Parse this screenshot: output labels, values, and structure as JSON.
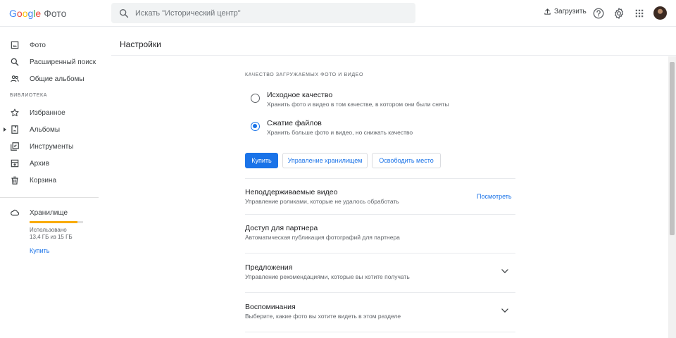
{
  "app": {
    "logo_g": "G",
    "logo_o1": "o",
    "logo_o2": "o",
    "logo_g2": "g",
    "logo_l": "l",
    "logo_e": "e",
    "product": "Фото"
  },
  "search": {
    "placeholder": "Искать \"Исторический центр\"",
    "icon": "search-icon"
  },
  "toolbar": {
    "upload_label": "Загрузить",
    "icons": [
      "upload-icon",
      "help-icon",
      "gear-icon",
      "apps-grid-icon",
      "avatar"
    ]
  },
  "sidebar": {
    "items": [
      {
        "label": "Фото",
        "icon": "photo-icon"
      },
      {
        "label": "Расширенный поиск",
        "icon": "search-icon"
      },
      {
        "label": "Общие альбомы",
        "icon": "people-icon"
      }
    ],
    "library_label": "БИБЛИОТЕКА",
    "library_items": [
      {
        "label": "Избранное",
        "icon": "star-icon"
      },
      {
        "label": "Альбомы",
        "icon": "album-icon"
      },
      {
        "label": "Инструменты",
        "icon": "tools-icon"
      },
      {
        "label": "Архив",
        "icon": "archive-icon"
      },
      {
        "label": "Корзина",
        "icon": "trash-icon"
      }
    ],
    "storage": {
      "label": "Хранилище",
      "used_label": "Использовано",
      "used_value": "13,4 ГБ из 15 ГБ",
      "used_fraction": 0.893,
      "bar_color": "#f9ab00",
      "buy_label": "Купить"
    }
  },
  "main": {
    "title": "Настройки",
    "upload_quality_label": "КАЧЕСТВО ЗАГРУЖАЕМЫХ ФОТО И ВИДЕО",
    "options": [
      {
        "title": "Исходное качество",
        "desc": "Хранить фото и видео в том качестве, в котором они были сняты",
        "checked": false
      },
      {
        "title": "Сжатие файлов",
        "desc": "Хранить больше фото и видео, но снижать качество",
        "checked": true
      }
    ],
    "buttons": {
      "buy": "Купить",
      "manage": "Управление хранилищем",
      "free": "Освободить место"
    },
    "rows": [
      {
        "title": "Неподдерживаемые видео",
        "desc": "Управление роликами, которые не удалось обработать",
        "action": "Посмотреть"
      },
      {
        "title": "Доступ для партнера",
        "desc": "Автоматическая публикация фотографий для партнера"
      },
      {
        "title": "Предложения",
        "desc": "Управление рекомендациями, которые вы хотите получать"
      },
      {
        "title": "Воспоминания",
        "desc": "Выберите, какие фото вы хотите видеть в этом разделе"
      }
    ]
  },
  "colors": {
    "accent": "#1a73e8",
    "storage": "#f9ab00"
  }
}
